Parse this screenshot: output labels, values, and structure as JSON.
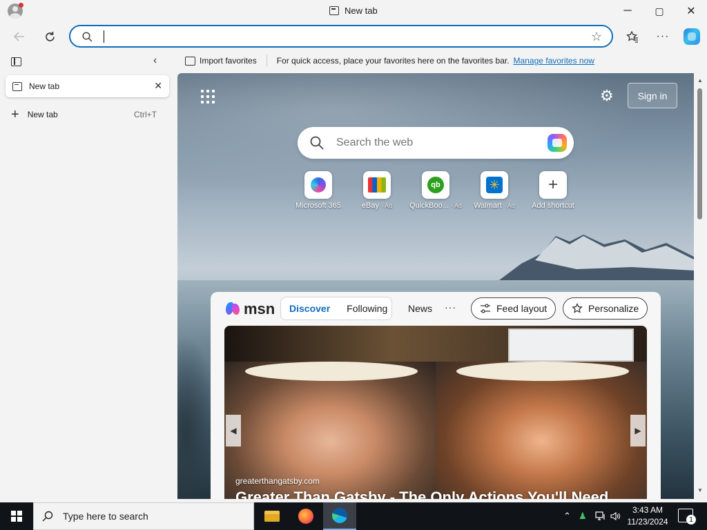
{
  "window": {
    "title": "New tab",
    "controls": {
      "minimize": "─",
      "maximize": "▢",
      "close": "✕"
    }
  },
  "toolbar": {
    "address_value": "",
    "address_placeholder": ""
  },
  "favorites_bar": {
    "import_label": "Import favorites",
    "message": "For quick access, place your favorites here on the favorites bar.",
    "manage_link": "Manage favorites now"
  },
  "sidebar": {
    "tabs": [
      {
        "label": "New tab"
      }
    ],
    "new_tab_label": "New tab",
    "new_tab_shortcut": "Ctrl+T"
  },
  "newtab_page": {
    "signin_label": "Sign in",
    "search_placeholder": "Search the web",
    "shortcuts": [
      {
        "name": "Microsoft 365",
        "ad": ""
      },
      {
        "name": "eBay",
        "ad": "· Ad"
      },
      {
        "name": "QuickBoo...",
        "ad": "· Ad"
      },
      {
        "name": "Walmart",
        "ad": "· Ad"
      },
      {
        "name": "Add shortcut",
        "ad": ""
      }
    ],
    "walmart_glyph": "✳",
    "qb_glyph": "qb",
    "plus_glyph": "+"
  },
  "msn": {
    "logo_text": "msn",
    "tabs": [
      {
        "label": "Discover",
        "active": true
      },
      {
        "label": "Following",
        "active": false
      }
    ],
    "news_label": "News",
    "more_label": "···",
    "feed_layout_label": "Feed layout",
    "personalize_label": "Personalize",
    "hero": {
      "source": "greaterthangatsby.com",
      "title": "Greater Than Gatsby - The Only Actions You'll Need"
    }
  },
  "taskbar": {
    "search_placeholder": "Type here to search",
    "time": "3:43 AM",
    "date": "11/23/2024",
    "notification_count": "1"
  },
  "colors": {
    "accent": "#0f6cbd",
    "taskbar_bg": "#101418",
    "chrome_bg": "#f3f3f3"
  }
}
